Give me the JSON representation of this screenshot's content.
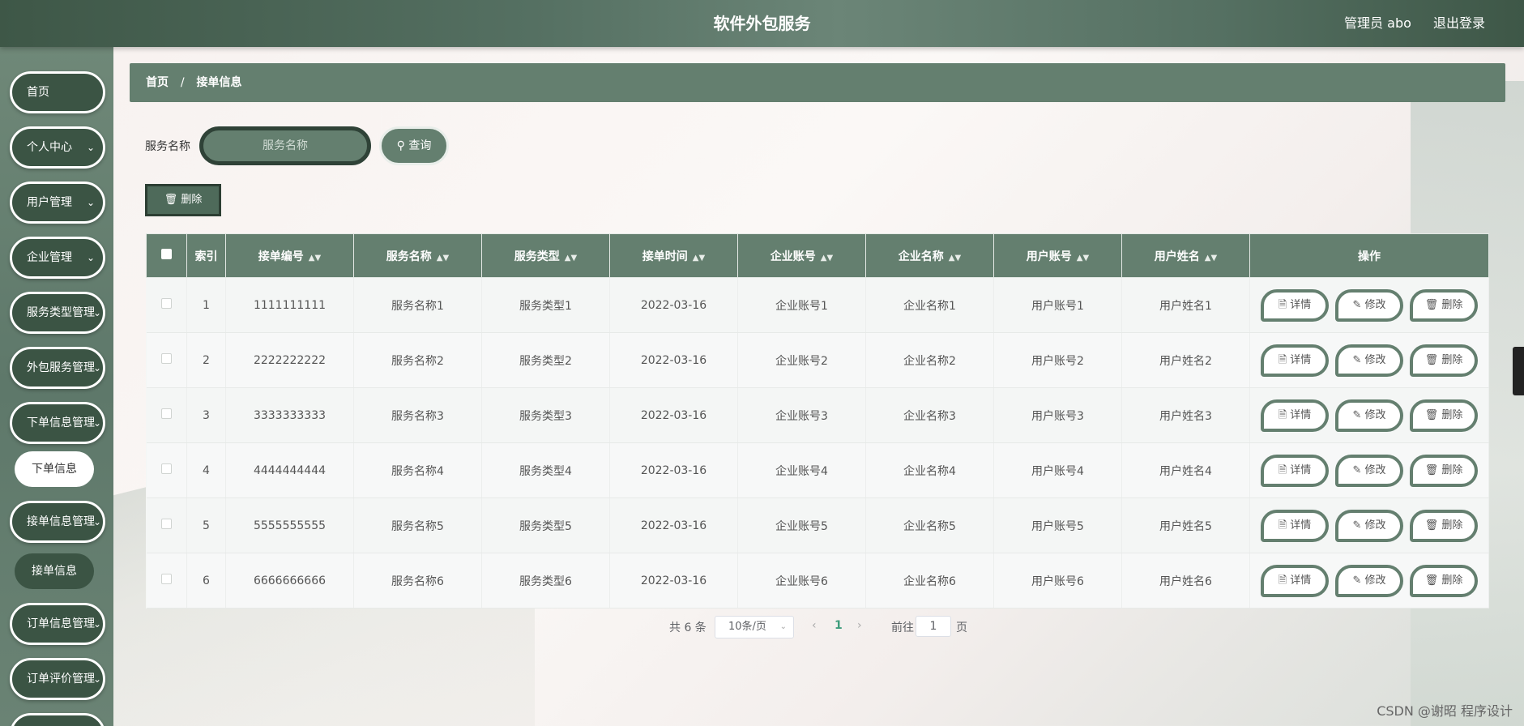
{
  "header": {
    "title": "软件外包服务",
    "user": "管理员 abo",
    "logout": "退出登录"
  },
  "sidebar": {
    "items": [
      {
        "label": "首页",
        "has_chevron": false
      },
      {
        "label": "个人中心",
        "has_chevron": true
      },
      {
        "label": "用户管理",
        "has_chevron": true
      },
      {
        "label": "企业管理",
        "has_chevron": true
      },
      {
        "label": "服务类型管理",
        "has_chevron": true
      },
      {
        "label": "外包服务管理",
        "has_chevron": true
      },
      {
        "label": "下单信息管理",
        "has_chevron": true
      },
      {
        "label": "接单信息管理",
        "has_chevron": true
      },
      {
        "label": "订单信息管理",
        "has_chevron": true
      },
      {
        "label": "订单评价管理",
        "has_chevron": true
      }
    ],
    "sub_order": "下单信息",
    "sub_accept": "接单信息"
  },
  "breadcrumb": {
    "home": "首页",
    "sep": "/",
    "current": "接单信息"
  },
  "search": {
    "label": "服务名称",
    "placeholder": "服务名称",
    "button": "查询"
  },
  "toolbar": {
    "delete": "删除"
  },
  "table": {
    "columns": [
      "索引",
      "接单编号",
      "服务名称",
      "服务类型",
      "接单时间",
      "企业账号",
      "企业名称",
      "用户账号",
      "用户姓名",
      "操作"
    ],
    "rows": [
      {
        "idx": "1",
        "no": "1111111111",
        "service": "服务名称1",
        "type": "服务类型1",
        "time": "2022-03-16",
        "account": "企业账号1",
        "company": "企业名称1",
        "user_account": "用户账号1",
        "user_name": "用户姓名1"
      },
      {
        "idx": "2",
        "no": "2222222222",
        "service": "服务名称2",
        "type": "服务类型2",
        "time": "2022-03-16",
        "account": "企业账号2",
        "company": "企业名称2",
        "user_account": "用户账号2",
        "user_name": "用户姓名2"
      },
      {
        "idx": "3",
        "no": "3333333333",
        "service": "服务名称3",
        "type": "服务类型3",
        "time": "2022-03-16",
        "account": "企业账号3",
        "company": "企业名称3",
        "user_account": "用户账号3",
        "user_name": "用户姓名3"
      },
      {
        "idx": "4",
        "no": "4444444444",
        "service": "服务名称4",
        "type": "服务类型4",
        "time": "2022-03-16",
        "account": "企业账号4",
        "company": "企业名称4",
        "user_account": "用户账号4",
        "user_name": "用户姓名4"
      },
      {
        "idx": "5",
        "no": "5555555555",
        "service": "服务名称5",
        "type": "服务类型5",
        "time": "2022-03-16",
        "account": "企业账号5",
        "company": "企业名称5",
        "user_account": "用户账号5",
        "user_name": "用户姓名5"
      },
      {
        "idx": "6",
        "no": "6666666666",
        "service": "服务名称6",
        "type": "服务类型6",
        "time": "2022-03-16",
        "account": "企业账号6",
        "company": "企业名称6",
        "user_account": "用户账号6",
        "user_name": "用户姓名6"
      }
    ],
    "actions": {
      "detail": "详情",
      "edit": "修改",
      "delete": "删除"
    }
  },
  "pagination": {
    "total": "共 6 条",
    "page_size": "10条/页",
    "current_page": "1",
    "goto_label": "前往",
    "goto_value": "1",
    "page_unit": "页"
  },
  "watermark": "CSDN @谢昭  程序设计",
  "colors": {
    "primary": "#647f6f",
    "dark": "#3b5444",
    "header": "#557062"
  }
}
